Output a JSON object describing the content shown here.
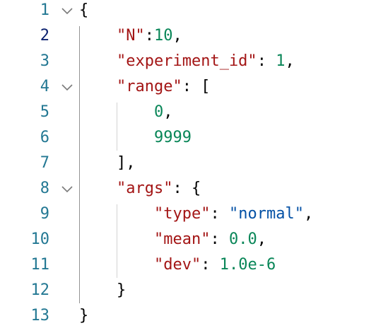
{
  "editor": {
    "active_line": 2,
    "lines": [
      {
        "number": "1",
        "fold": true,
        "indent": 0,
        "tokens": [
          {
            "t": "punc",
            "v": "{"
          }
        ]
      },
      {
        "number": "2",
        "fold": false,
        "indent": 1,
        "tokens": [
          {
            "t": "key",
            "v": "\"N\""
          },
          {
            "t": "punc",
            "v": ":"
          },
          {
            "t": "num",
            "v": "10"
          },
          {
            "t": "punc",
            "v": ","
          }
        ]
      },
      {
        "number": "3",
        "fold": false,
        "indent": 1,
        "tokens": [
          {
            "t": "key",
            "v": "\"experiment_id\""
          },
          {
            "t": "punc",
            "v": ": "
          },
          {
            "t": "num",
            "v": "1"
          },
          {
            "t": "punc",
            "v": ","
          }
        ]
      },
      {
        "number": "4",
        "fold": true,
        "indent": 1,
        "tokens": [
          {
            "t": "key",
            "v": "\"range\""
          },
          {
            "t": "punc",
            "v": ": ["
          }
        ]
      },
      {
        "number": "5",
        "fold": false,
        "indent": 2,
        "tokens": [
          {
            "t": "num",
            "v": "0"
          },
          {
            "t": "punc",
            "v": ","
          }
        ]
      },
      {
        "number": "6",
        "fold": false,
        "indent": 2,
        "tokens": [
          {
            "t": "num",
            "v": "9999"
          }
        ]
      },
      {
        "number": "7",
        "fold": false,
        "indent": 1,
        "tokens": [
          {
            "t": "punc",
            "v": "],"
          }
        ]
      },
      {
        "number": "8",
        "fold": true,
        "indent": 1,
        "tokens": [
          {
            "t": "key",
            "v": "\"args\""
          },
          {
            "t": "punc",
            "v": ": {"
          }
        ]
      },
      {
        "number": "9",
        "fold": false,
        "indent": 2,
        "tokens": [
          {
            "t": "key",
            "v": "\"type\""
          },
          {
            "t": "punc",
            "v": ": "
          },
          {
            "t": "str",
            "v": "\"normal\""
          },
          {
            "t": "punc",
            "v": ","
          }
        ]
      },
      {
        "number": "10",
        "fold": false,
        "indent": 2,
        "tokens": [
          {
            "t": "key",
            "v": "\"mean\""
          },
          {
            "t": "punc",
            "v": ": "
          },
          {
            "t": "num",
            "v": "0.0"
          },
          {
            "t": "punc",
            "v": ","
          }
        ]
      },
      {
        "number": "11",
        "fold": false,
        "indent": 2,
        "tokens": [
          {
            "t": "key",
            "v": "\"dev\""
          },
          {
            "t": "punc",
            "v": ": "
          },
          {
            "t": "num",
            "v": "1.0e-6"
          }
        ]
      },
      {
        "number": "12",
        "fold": false,
        "indent": 1,
        "tokens": [
          {
            "t": "punc",
            "v": "}"
          }
        ]
      },
      {
        "number": "13",
        "fold": false,
        "indent": 0,
        "tokens": [
          {
            "t": "punc",
            "v": "}"
          }
        ]
      }
    ],
    "fold_icon": "chevron-down-icon",
    "colors": {
      "key": "#a31515",
      "number": "#098658",
      "string": "#0451a5",
      "punctuation": "#000000",
      "line_number": "#237893",
      "active_line_number": "#0b216f",
      "indent_guide": "#d3d3d3",
      "active_indent_guide": "#939393"
    }
  }
}
